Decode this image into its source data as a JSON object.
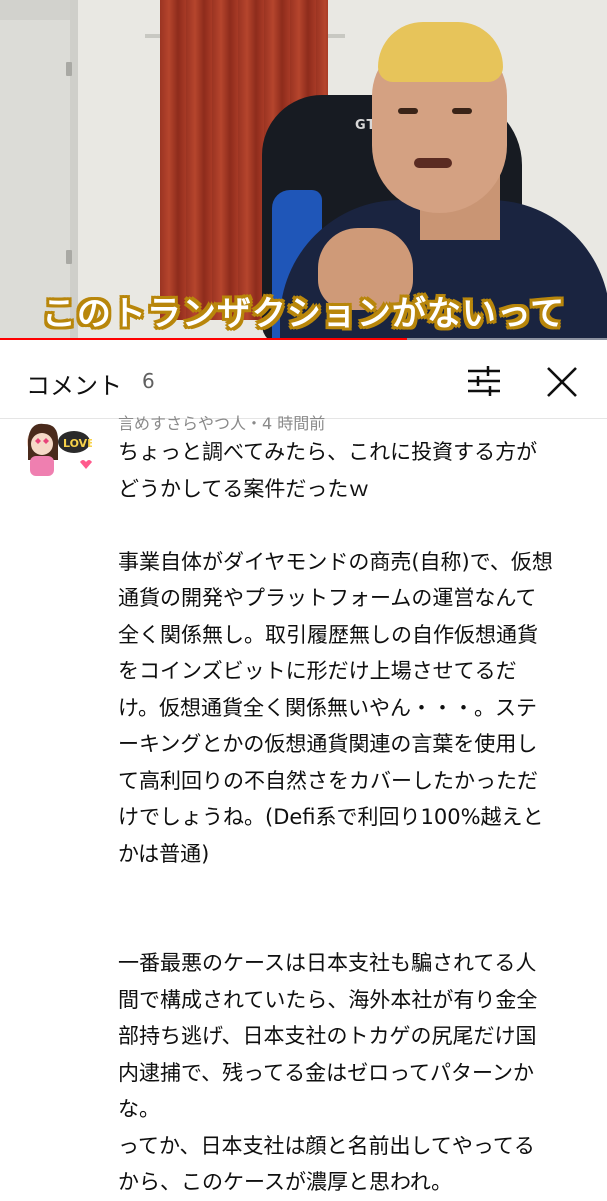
{
  "video": {
    "subtitle": "このトランザクションがないって",
    "chair_brand": "GT",
    "progress_fraction": 0.67
  },
  "comments_panel": {
    "title": "コメント",
    "count": "6",
    "filter_icon": "sort-filter-icon",
    "close_icon": "close-icon"
  },
  "comment": {
    "author_meta": "言めすさらやつ人・4 時間前",
    "text": "ちょっと調べてみたら、これに投資する方が\nどうかしてる案件だったｗ\n\n事業自体がダイヤモンドの商売(自称)で、仮想\n通貨の開発やプラットフォームの運営なんて\n全く関係無し。取引履歴無しの自作仮想通貨\nをコインズビットに形だけ上場させてるだ\nけ。仮想通貨全く関係無いやん・・・。ステ\nーキングとかの仮想通貨関連の言葉を使用し\nて高利回りの不自然さをカバーしたかっただ\nけでしょうね。(Defi系で利回り100%越えと\nかは普通)\n\n\n一番最悪のケースは日本支社も騙されてる人\n間で構成されていたら、海外本社が有り金全\n部持ち逃げ、日本支社のトカゲの尻尾だけ国\n内逮捕で、残ってる金はゼロってパターンか\nな。\nってか、日本支社は顔と名前出してやってる\nから、このケースが濃厚と思われ。"
  },
  "colors": {
    "progress": "#ff0000",
    "subtitle_outline": "#b8860b",
    "text": "#0f0f0f",
    "meta": "#8a8a8a"
  }
}
